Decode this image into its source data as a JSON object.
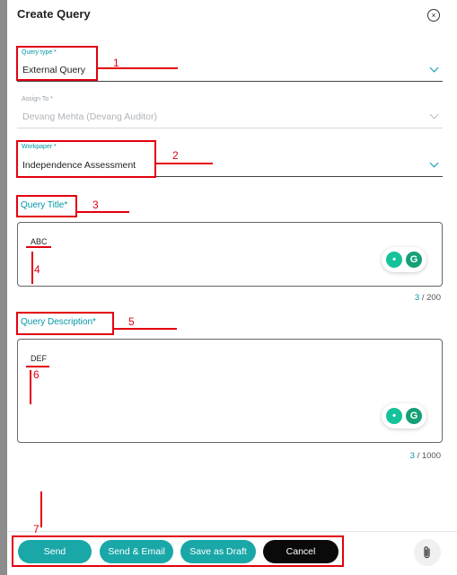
{
  "dialog": {
    "title": "Create Query"
  },
  "fields": {
    "query_type": {
      "label": "Query type *",
      "value": "External Query"
    },
    "assign_to": {
      "label": "Assign To *",
      "value": "Devang Mehta (Devang Auditor)"
    },
    "workpaper": {
      "label": "Workpaper *",
      "value": "Independence Assessment"
    },
    "query_title": {
      "label": "Query Title*",
      "value": "ABC",
      "count": "3",
      "max": "/ 200"
    },
    "query_description": {
      "label": "Query Description*",
      "value": "DEF",
      "count": "3",
      "max": "/ 1000"
    }
  },
  "footer": {
    "send": "Send",
    "send_email": "Send & Email",
    "save_draft": "Save as Draft",
    "cancel": "Cancel"
  },
  "annotations": [
    "1",
    "2",
    "3",
    "4",
    "5",
    "6",
    "7"
  ],
  "colors": {
    "accent": "#0097a7",
    "button": "#1aa7a7",
    "annotation": "#e3000f"
  }
}
